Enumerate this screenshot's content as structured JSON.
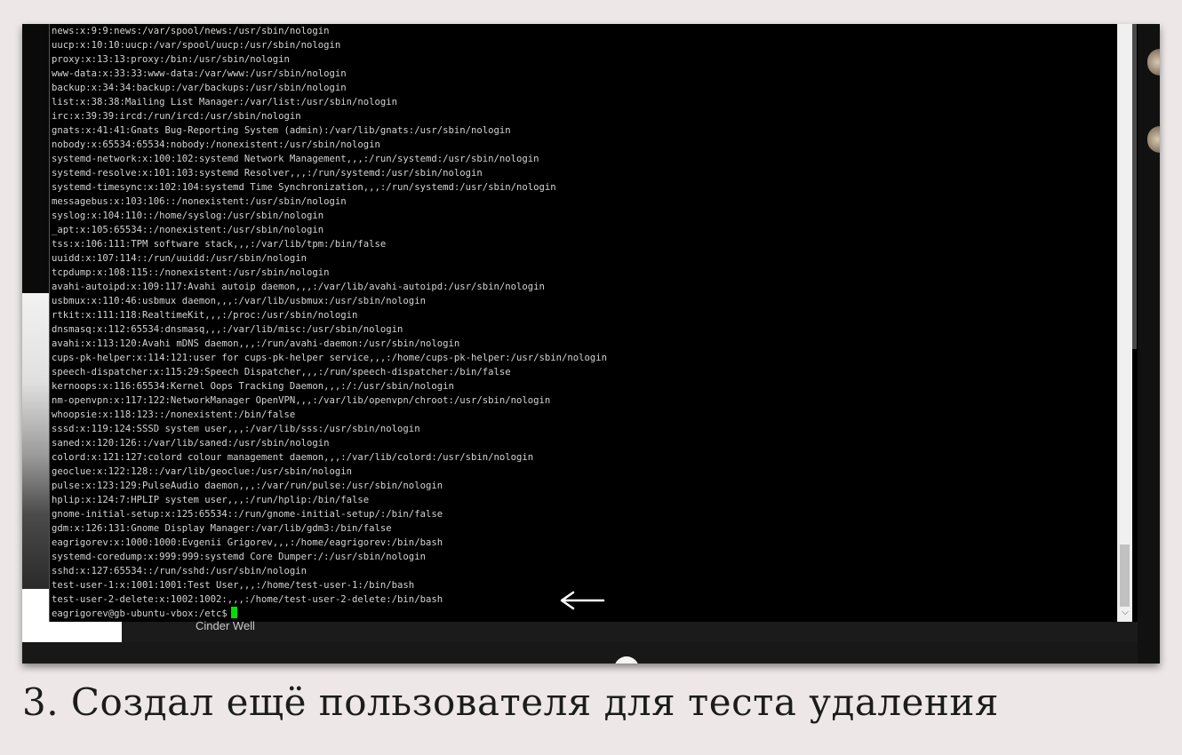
{
  "terminal": {
    "lines": [
      "news:x:9:9:news:/var/spool/news:/usr/sbin/nologin",
      "uucp:x:10:10:uucp:/var/spool/uucp:/usr/sbin/nologin",
      "proxy:x:13:13:proxy:/bin:/usr/sbin/nologin",
      "www-data:x:33:33:www-data:/var/www:/usr/sbin/nologin",
      "backup:x:34:34:backup:/var/backups:/usr/sbin/nologin",
      "list:x:38:38:Mailing List Manager:/var/list:/usr/sbin/nologin",
      "irc:x:39:39:ircd:/run/ircd:/usr/sbin/nologin",
      "gnats:x:41:41:Gnats Bug-Reporting System (admin):/var/lib/gnats:/usr/sbin/nologin",
      "nobody:x:65534:65534:nobody:/nonexistent:/usr/sbin/nologin",
      "systemd-network:x:100:102:systemd Network Management,,,:/run/systemd:/usr/sbin/nologin",
      "systemd-resolve:x:101:103:systemd Resolver,,,:/run/systemd:/usr/sbin/nologin",
      "systemd-timesync:x:102:104:systemd Time Synchronization,,,:/run/systemd:/usr/sbin/nologin",
      "messagebus:x:103:106::/nonexistent:/usr/sbin/nologin",
      "syslog:x:104:110::/home/syslog:/usr/sbin/nologin",
      "_apt:x:105:65534::/nonexistent:/usr/sbin/nologin",
      "tss:x:106:111:TPM software stack,,,:/var/lib/tpm:/bin/false",
      "uuidd:x:107:114::/run/uuidd:/usr/sbin/nologin",
      "tcpdump:x:108:115::/nonexistent:/usr/sbin/nologin",
      "avahi-autoipd:x:109:117:Avahi autoip daemon,,,:/var/lib/avahi-autoipd:/usr/sbin/nologin",
      "usbmux:x:110:46:usbmux daemon,,,:/var/lib/usbmux:/usr/sbin/nologin",
      "rtkit:x:111:118:RealtimeKit,,,:/proc:/usr/sbin/nologin",
      "dnsmasq:x:112:65534:dnsmasq,,,:/var/lib/misc:/usr/sbin/nologin",
      "avahi:x:113:120:Avahi mDNS daemon,,,:/run/avahi-daemon:/usr/sbin/nologin",
      "cups-pk-helper:x:114:121:user for cups-pk-helper service,,,:/home/cups-pk-helper:/usr/sbin/nologin",
      "speech-dispatcher:x:115:29:Speech Dispatcher,,,:/run/speech-dispatcher:/bin/false",
      "kernoops:x:116:65534:Kernel Oops Tracking Daemon,,,:/:/usr/sbin/nologin",
      "nm-openvpn:x:117:122:NetworkManager OpenVPN,,,:/var/lib/openvpn/chroot:/usr/sbin/nologin",
      "whoopsie:x:118:123::/nonexistent:/bin/false",
      "sssd:x:119:124:SSSD system user,,,:/var/lib/sss:/usr/sbin/nologin",
      "saned:x:120:126::/var/lib/saned:/usr/sbin/nologin",
      "colord:x:121:127:colord colour management daemon,,,:/var/lib/colord:/usr/sbin/nologin",
      "geoclue:x:122:128::/var/lib/geoclue:/usr/sbin/nologin",
      "pulse:x:123:129:PulseAudio daemon,,,:/var/run/pulse:/usr/sbin/nologin",
      "hplip:x:124:7:HPLIP system user,,,:/run/hplip:/bin/false",
      "gnome-initial-setup:x:125:65534::/run/gnome-initial-setup/:/bin/false",
      "gdm:x:126:131:Gnome Display Manager:/var/lib/gdm3:/bin/false",
      "eagrigorev:x:1000:1000:Evgenii Grigorev,,,:/home/eagrigorev:/bin/bash",
      "systemd-coredump:x:999:999:systemd Core Dumper:/:/usr/sbin/nologin",
      "sshd:x:127:65534::/run/sshd:/usr/sbin/nologin",
      "test-user-1:x:1001:1001:Test User,,,:/home/test-user-1:/bin/bash",
      "test-user-2-delete:x:1002:1002:,,,:/home/test-user-2-delete:/bin/bash"
    ],
    "prompt": "eagrigorev@gb-ubuntu-vbox:/etc$",
    "cursor_color": "#00e000"
  },
  "background": {
    "caption": "Cinder Well"
  },
  "annotation": {
    "arrow_color": "#ffffff",
    "icon": "left-arrow-icon"
  },
  "caption": {
    "text": "3. Создал ещё пользователя для теста удаления"
  },
  "icons": {
    "scroll_down": "chevron-down-icon"
  }
}
